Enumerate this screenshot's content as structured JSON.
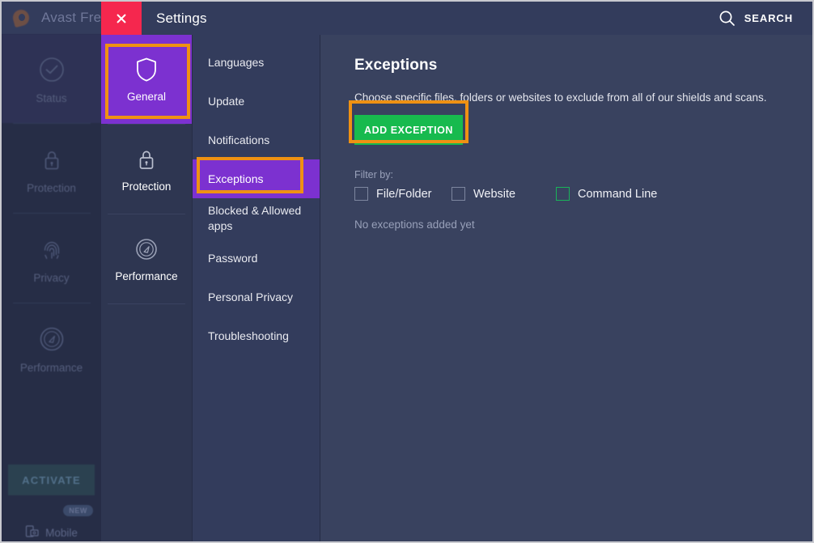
{
  "background_app": {
    "title": "Avast Free A",
    "logo_icon": "avast-logo-icon",
    "nav_items": [
      {
        "label": "Status",
        "icon": "check-circle-icon",
        "active": true
      },
      {
        "label": "Protection",
        "icon": "lock-icon",
        "active": false
      },
      {
        "label": "Privacy",
        "icon": "fingerprint-icon",
        "active": false
      },
      {
        "label": "Performance",
        "icon": "speedometer-icon",
        "active": false
      }
    ],
    "activate_label": "ACTIVATE",
    "mobile_label": "Mobile",
    "mobile_icon": "mobile-device-icon",
    "new_badge": "NEW"
  },
  "window": {
    "title": "Settings",
    "close_icon": "close-icon",
    "close_color": "#f5274e",
    "search_label": "SEARCH",
    "search_icon": "search-icon"
  },
  "categories": [
    {
      "label": "General",
      "icon": "shield-icon",
      "active": true
    },
    {
      "label": "Protection",
      "icon": "lock-icon",
      "active": false
    },
    {
      "label": "Performance",
      "icon": "speedometer-icon",
      "active": false
    }
  ],
  "nav": {
    "items": [
      {
        "label": "Languages",
        "active": false
      },
      {
        "label": "Update",
        "active": false
      },
      {
        "label": "Notifications",
        "active": false
      },
      {
        "label": "Exceptions",
        "active": true
      },
      {
        "label": "Blocked & Allowed apps",
        "active": false
      },
      {
        "label": "Password",
        "active": false
      },
      {
        "label": "Personal Privacy",
        "active": false
      },
      {
        "label": "Troubleshooting",
        "active": false
      }
    ]
  },
  "main": {
    "title": "Exceptions",
    "description": "Choose specific files, folders or websites to exclude from all of our shields and scans.",
    "add_button": "ADD EXCEPTION",
    "add_button_color": "#17ba4e",
    "filter_label": "Filter by:",
    "filters": [
      {
        "label": "File/Folder",
        "checked": false,
        "highlighted": false
      },
      {
        "label": "Website",
        "checked": false,
        "highlighted": false
      },
      {
        "label": "Command Line",
        "checked": false,
        "highlighted": true
      }
    ],
    "empty_state": "No exceptions added yet"
  },
  "annotations": {
    "color": "#ef9113",
    "boxes": [
      "general-category-tile",
      "exceptions-nav-item",
      "add-exception-button"
    ]
  }
}
